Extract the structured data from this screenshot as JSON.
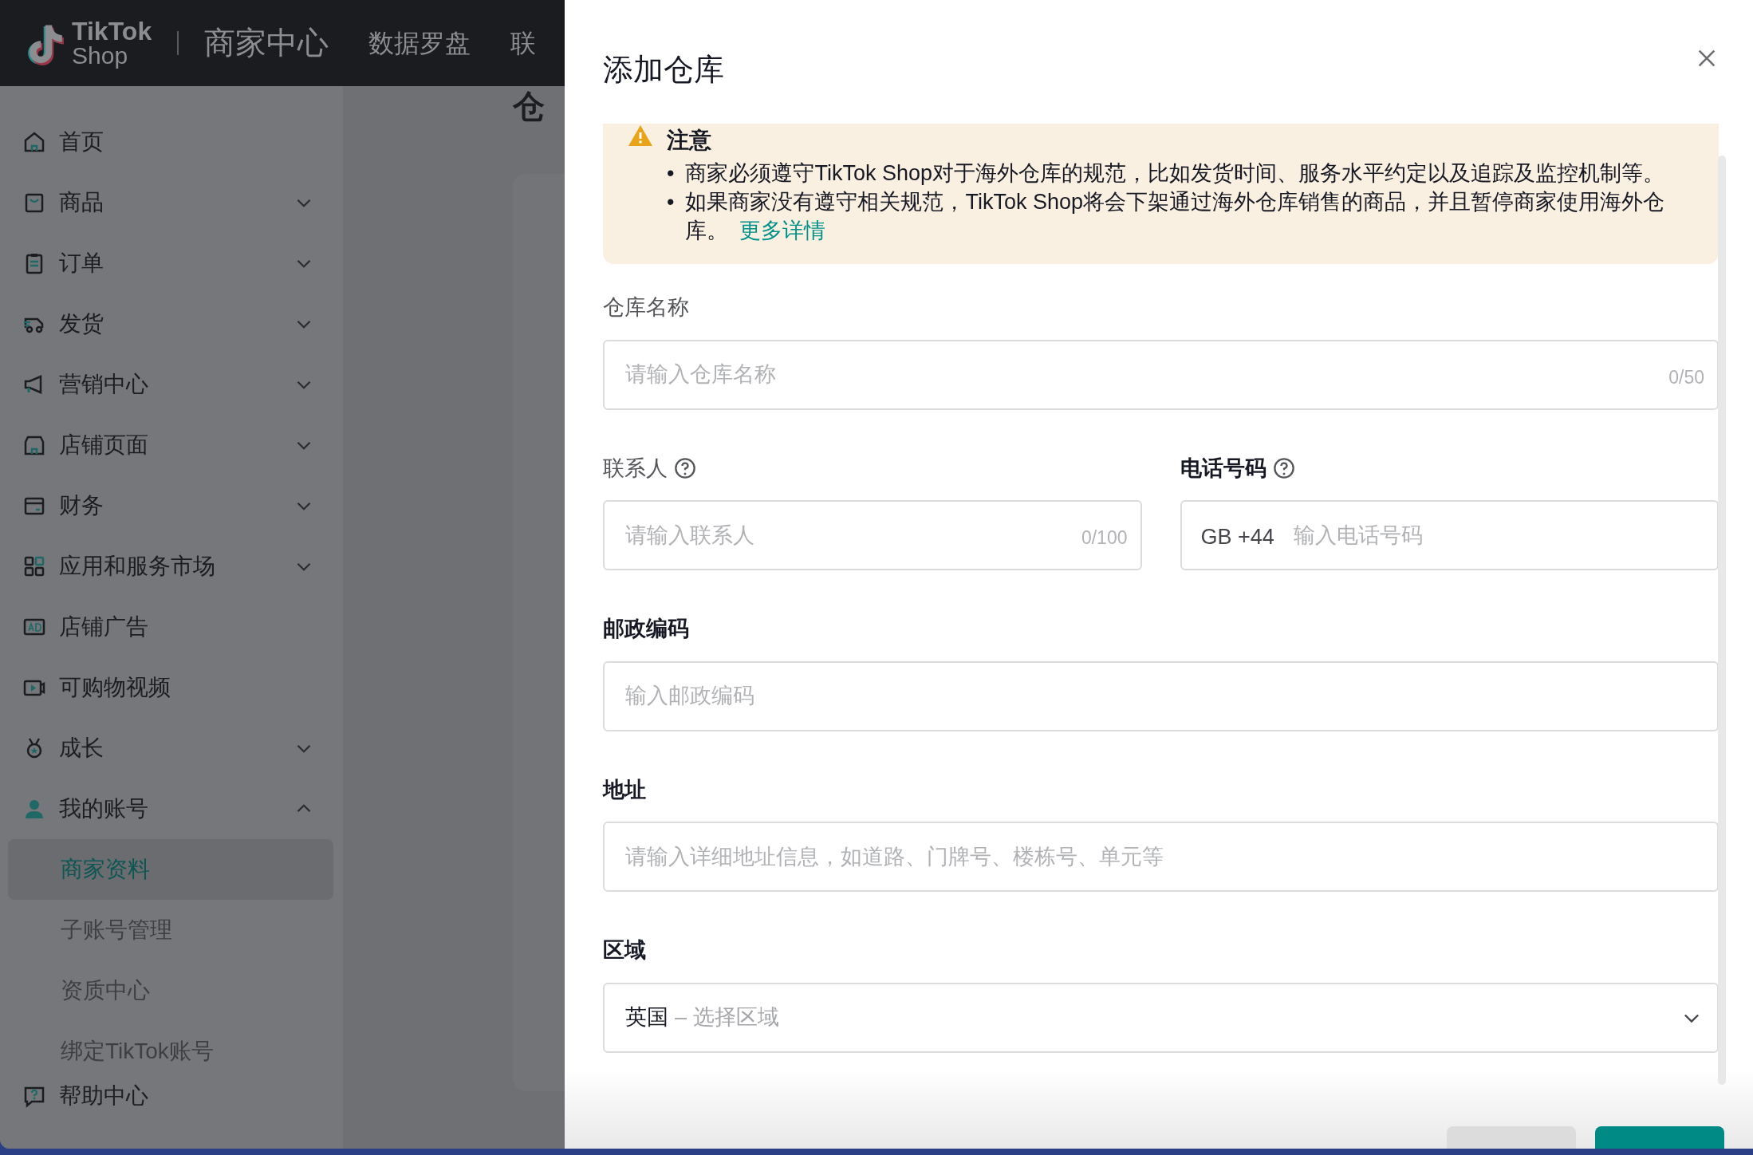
{
  "header": {
    "logo": {
      "line1": "TikTok",
      "line2": "Shop"
    },
    "title": "商家中心",
    "nav": [
      "数据罗盘",
      "联"
    ]
  },
  "sidebar": {
    "items": [
      {
        "label": "首页"
      },
      {
        "label": "商品",
        "expanded": false
      },
      {
        "label": "订单",
        "expanded": false
      },
      {
        "label": "发货",
        "expanded": false
      },
      {
        "label": "营销中心",
        "expanded": false
      },
      {
        "label": "店铺页面",
        "expanded": false
      },
      {
        "label": "财务",
        "expanded": false
      },
      {
        "label": "应用和服务市场",
        "expanded": false
      },
      {
        "label": "店铺广告"
      },
      {
        "label": "可购物视频"
      },
      {
        "label": "成长",
        "expanded": false
      },
      {
        "label": "我的账号",
        "expanded": true,
        "children": [
          {
            "label": "商家资料",
            "selected": true
          },
          {
            "label": "子账号管理",
            "selected": false
          },
          {
            "label": "资质中心",
            "selected": false
          },
          {
            "label": "绑定TikTok账号",
            "selected": false
          }
        ]
      },
      {
        "label": "帮助中心"
      }
    ]
  },
  "page": {
    "title": "仓"
  },
  "drawer": {
    "title": "添加仓库",
    "notice": {
      "heading": "注意",
      "bullets": [
        {
          "marker": "•",
          "text": "商家必须遵守TikTok Shop对于海外仓库的规范，比如发货时间、服务水平约定以及追踪及监控机制等。"
        },
        {
          "marker": "•",
          "text": "如果商家没有遵守相关规范，TikTok Shop将会下架通过海外仓库销售的商品，并且暂停商家使用海外仓库。",
          "link": "更多详情"
        }
      ]
    },
    "rows": [
      [
        {
          "kind": "text",
          "label": "仓库名称",
          "emphasized": false,
          "placeholder": "请输入仓库名称",
          "counter": "0/50"
        }
      ],
      [
        {
          "kind": "text",
          "label": "联系人",
          "emphasized": false,
          "help": true,
          "placeholder": "请输入联系人",
          "counter": "0/100"
        },
        {
          "kind": "phone",
          "label": "电话号码",
          "emphasized": true,
          "help": true,
          "prefix": "GB +44",
          "placeholder": "输入电话号码"
        }
      ],
      [
        {
          "kind": "text",
          "label": "邮政编码",
          "emphasized": true,
          "placeholder": "输入邮政编码"
        }
      ],
      [
        {
          "kind": "text",
          "label": "地址",
          "emphasized": true,
          "placeholder": "请输入详细地址信息，如道路、门牌号、楼栋号、单元等"
        }
      ],
      [
        {
          "kind": "select",
          "label": "区域",
          "emphasized": true,
          "value": "英国",
          "placeholder": "– 选择区域"
        }
      ]
    ],
    "footer_buttons": [
      {
        "kind": "secondary"
      },
      {
        "kind": "primary"
      }
    ]
  }
}
